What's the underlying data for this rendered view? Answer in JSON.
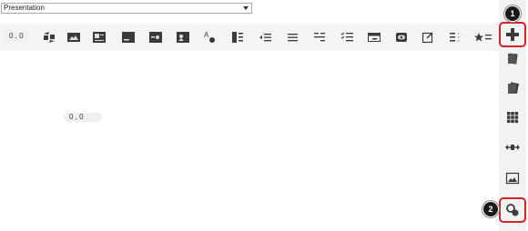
{
  "dropdown": {
    "selected": "Presentation"
  },
  "toolbar": {
    "counter": "0 , 0"
  },
  "canvas": {
    "counter": "0 , 0"
  },
  "callouts": [
    "1",
    "2"
  ],
  "colors": {
    "accent": "#d2232a",
    "icon": "#3a3a3a",
    "toolbar_bg": "#f4f4f4",
    "sidebar_bg": "#f2f2f2"
  },
  "toolbar_icons": [
    "replace-image-icon",
    "image-icon",
    "image-left-text-icon",
    "image-caption-icon",
    "media-icon",
    "image-right-text-icon",
    "text-styles-icon",
    "columns-icon",
    "bullet-list-icon",
    "plain-list-icon",
    "indent-list-icon",
    "checklist-icon",
    "window-icon",
    "eye-icon",
    "edit-icon",
    "vertical-dots-icon",
    "star-list-icon"
  ],
  "sidebar_icons": [
    "add-icon",
    "card-stack-icon",
    "card-icon",
    "grid-icon",
    "move-icon",
    "picture-icon",
    "search-settings-icon"
  ]
}
